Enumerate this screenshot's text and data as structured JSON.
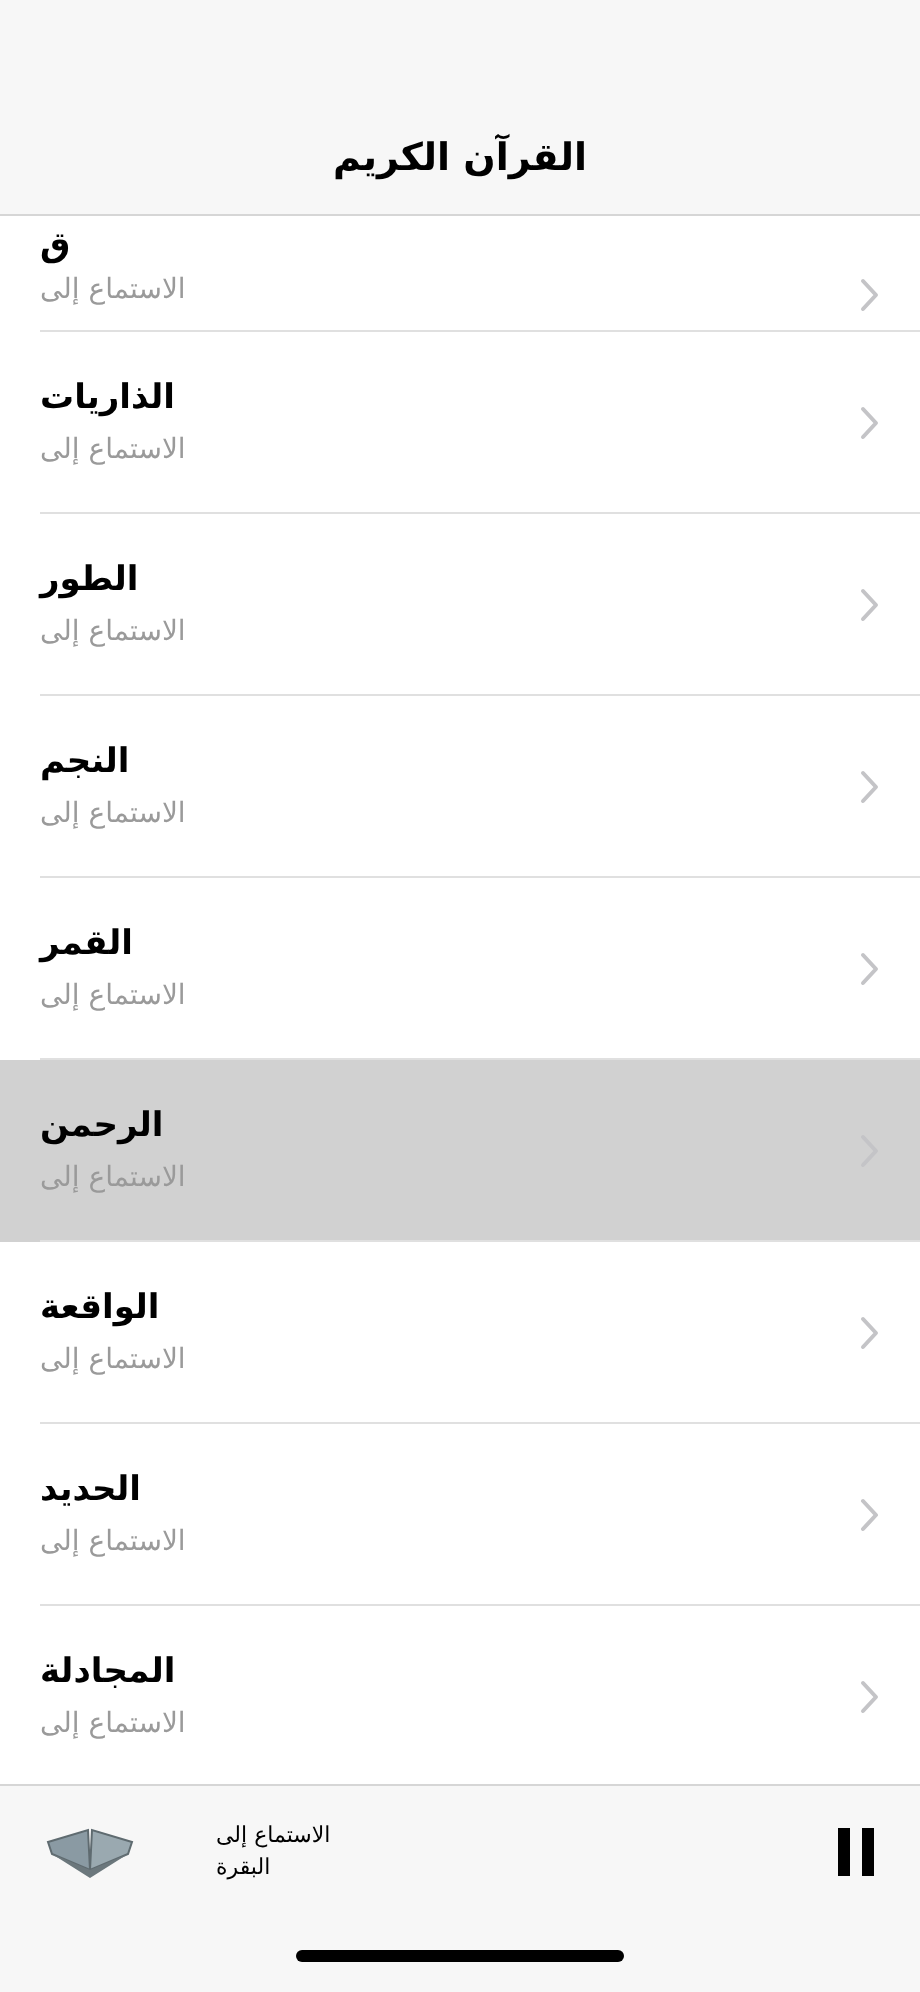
{
  "header": {
    "title": "القرآن الكريم"
  },
  "surahs": [
    {
      "name": "ق",
      "subtitle": "الاستماع إلى",
      "selected": false
    },
    {
      "name": "الذاريات",
      "subtitle": "الاستماع إلى",
      "selected": false
    },
    {
      "name": "الطور",
      "subtitle": "الاستماع إلى",
      "selected": false
    },
    {
      "name": "النجم",
      "subtitle": "الاستماع إلى",
      "selected": false
    },
    {
      "name": "القمر",
      "subtitle": "الاستماع إلى",
      "selected": false
    },
    {
      "name": "الرحمن",
      "subtitle": "الاستماع إلى",
      "selected": true
    },
    {
      "name": "الواقعة",
      "subtitle": "الاستماع إلى",
      "selected": false
    },
    {
      "name": "الحديد",
      "subtitle": "الاستماع إلى",
      "selected": false
    },
    {
      "name": "المجادلة",
      "subtitle": "الاستماع إلى",
      "selected": false
    }
  ],
  "player": {
    "label": "الاستماع إلى",
    "track": "البقرة",
    "playing": true
  }
}
